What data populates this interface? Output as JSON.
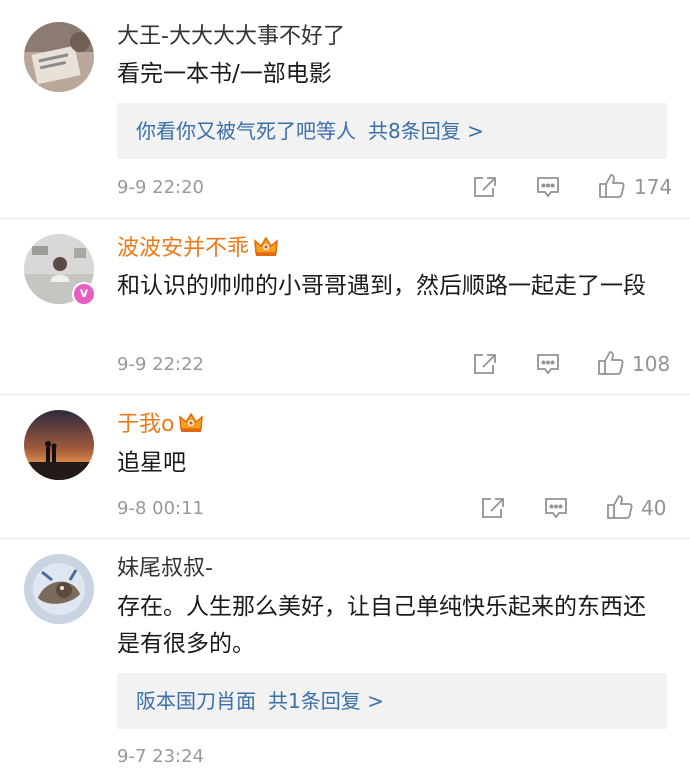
{
  "comments": [
    {
      "username": "大王-大大大大事不好了",
      "username_style": "plain",
      "content": "看完一本书/一部电影",
      "reply_preview": {
        "text": "你看你又被气死了吧等人",
        "count": "共8条回复 >"
      },
      "time": "9-9 22:20",
      "likes": "174"
    },
    {
      "username": "波波安并不乖",
      "username_style": "vip",
      "badge": "v",
      "content": "和认识的帅帅的小哥哥遇到，然后顺路一起走了一段",
      "time": "9-9 22:22",
      "likes": "108"
    },
    {
      "username": "于我o",
      "username_style": "vip",
      "content": "追星吧",
      "time": "9-8 00:11",
      "likes": "40"
    },
    {
      "username": "妹尾叔叔-",
      "username_style": "plain",
      "content": "存在。人生那么美好，让自己单纯快乐起来的东西还是有很多的。",
      "reply_preview": {
        "text": "阪本国刀肖面",
        "count": "共1条回复 >"
      },
      "time": "9-7 23:24"
    }
  ],
  "icons": {
    "share": "share-icon",
    "comment": "comment-icon",
    "like": "thumbs-up-icon",
    "crown": "vip-crown-icon"
  },
  "colors": {
    "vip_name": "#ee7a1a",
    "link_blue": "#3a6fa8",
    "reply_bg": "#f2f2f2",
    "meta_gray": "#999999"
  }
}
